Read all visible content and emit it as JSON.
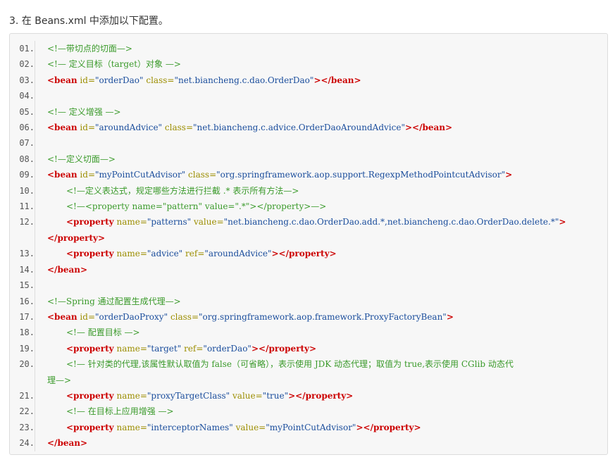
{
  "heading": "3. 在 Beans.xml 中添加以下配置。",
  "lines": [
    {
      "n": "01.",
      "ind": 0,
      "parts": [
        [
          "cmt",
          "<!—带切点的切面—>"
        ]
      ]
    },
    {
      "n": "02.",
      "ind": 0,
      "parts": [
        [
          "cmt",
          "<!— 定义目标（target）对象 —>"
        ]
      ]
    },
    {
      "n": "03.",
      "ind": 0,
      "parts": [
        [
          "tag",
          "<bean"
        ],
        [
          "sp",
          " "
        ],
        [
          "attr",
          "id="
        ],
        [
          "str",
          "\"orderDao\""
        ],
        [
          "sp",
          " "
        ],
        [
          "attr",
          "class="
        ],
        [
          "str",
          "\"net.biancheng.c.dao.OrderDao\""
        ],
        [
          "tag",
          "></bean>"
        ]
      ]
    },
    {
      "n": "04.",
      "ind": 0,
      "parts": []
    },
    {
      "n": "05.",
      "ind": 0,
      "parts": [
        [
          "cmt",
          "<!— 定义增强 —>"
        ]
      ]
    },
    {
      "n": "06.",
      "ind": 0,
      "parts": [
        [
          "tag",
          "<bean"
        ],
        [
          "sp",
          " "
        ],
        [
          "attr",
          "id="
        ],
        [
          "str",
          "\"aroundAdvice\""
        ],
        [
          "sp",
          " "
        ],
        [
          "attr",
          "class="
        ],
        [
          "str",
          "\"net.biancheng.c.advice.OrderDaoAroundAdvice\""
        ],
        [
          "tag",
          "></bean>"
        ]
      ]
    },
    {
      "n": "07.",
      "ind": 0,
      "parts": []
    },
    {
      "n": "08.",
      "ind": 0,
      "parts": [
        [
          "cmt",
          "<!—定义切面—>"
        ]
      ]
    },
    {
      "n": "09.",
      "ind": 0,
      "parts": [
        [
          "tag",
          "<bean"
        ],
        [
          "sp",
          " "
        ],
        [
          "attr",
          "id="
        ],
        [
          "str",
          "\"myPointCutAdvisor\""
        ],
        [
          "sp",
          " "
        ],
        [
          "attr",
          "class="
        ],
        [
          "str",
          "\"org.springframework.aop.support.RegexpMethodPointcutAdvisor\""
        ],
        [
          "tag",
          ">"
        ]
      ]
    },
    {
      "n": "10.",
      "ind": 1,
      "parts": [
        [
          "cmt",
          "<!—定义表达式，规定哪些方法进行拦截 .* 表示所有方法—>"
        ]
      ]
    },
    {
      "n": "11.",
      "ind": 1,
      "parts": [
        [
          "cmt",
          "<!—<property name=\"pattern\" value=\".*\"></property>—>"
        ]
      ]
    },
    {
      "n": "12.",
      "ind": 1,
      "parts": [
        [
          "tag",
          "<property"
        ],
        [
          "sp",
          " "
        ],
        [
          "attr",
          "name="
        ],
        [
          "str",
          "\"patterns\""
        ],
        [
          "sp",
          " "
        ],
        [
          "attr",
          "value="
        ],
        [
          "str",
          "\"net.biancheng.c.dao.OrderDao.add.*,net.biancheng.c.dao.OrderDao.delete.*\""
        ],
        [
          "tag",
          ">"
        ],
        [
          "br",
          ""
        ],
        [
          "tag",
          "</property>"
        ]
      ]
    },
    {
      "n": "13.",
      "ind": 1,
      "parts": [
        [
          "tag",
          "<property"
        ],
        [
          "sp",
          " "
        ],
        [
          "attr",
          "name="
        ],
        [
          "str",
          "\"advice\""
        ],
        [
          "sp",
          " "
        ],
        [
          "attr",
          "ref="
        ],
        [
          "str",
          "\"aroundAdvice\""
        ],
        [
          "tag",
          "></property>"
        ]
      ]
    },
    {
      "n": "14.",
      "ind": 0,
      "parts": [
        [
          "tag",
          "</bean>"
        ]
      ]
    },
    {
      "n": "15.",
      "ind": 0,
      "parts": []
    },
    {
      "n": "16.",
      "ind": 0,
      "parts": [
        [
          "cmt",
          "<!—Spring 通过配置生成代理—>"
        ]
      ]
    },
    {
      "n": "17.",
      "ind": 0,
      "parts": [
        [
          "tag",
          "<bean"
        ],
        [
          "sp",
          " "
        ],
        [
          "attr",
          "id="
        ],
        [
          "str",
          "\"orderDaoProxy\""
        ],
        [
          "sp",
          " "
        ],
        [
          "attr",
          "class="
        ],
        [
          "str",
          "\"org.springframework.aop.framework.ProxyFactoryBean\""
        ],
        [
          "tag",
          ">"
        ]
      ]
    },
    {
      "n": "18.",
      "ind": 1,
      "parts": [
        [
          "cmt",
          "<!— 配置目标 —>"
        ]
      ]
    },
    {
      "n": "19.",
      "ind": 1,
      "parts": [
        [
          "tag",
          "<property"
        ],
        [
          "sp",
          " "
        ],
        [
          "attr",
          "name="
        ],
        [
          "str",
          "\"target\""
        ],
        [
          "sp",
          " "
        ],
        [
          "attr",
          "ref="
        ],
        [
          "str",
          "\"orderDao\""
        ],
        [
          "tag",
          "></property>"
        ]
      ]
    },
    {
      "n": "20.",
      "ind": 1,
      "parts": [
        [
          "cmt",
          "<!— 针对类的代理,该属性默认取值为 false（可省略），表示使用 JDK 动态代理；取值为 true,表示使用 CGlib 动态代"
        ],
        [
          "br",
          ""
        ],
        [
          "cmt",
          "理—>"
        ]
      ]
    },
    {
      "n": "21.",
      "ind": 1,
      "parts": [
        [
          "tag",
          "<property"
        ],
        [
          "sp",
          " "
        ],
        [
          "attr",
          "name="
        ],
        [
          "str",
          "\"proxyTargetClass\""
        ],
        [
          "sp",
          " "
        ],
        [
          "attr",
          "value="
        ],
        [
          "str",
          "\"true\""
        ],
        [
          "tag",
          "></property>"
        ]
      ]
    },
    {
      "n": "22.",
      "ind": 1,
      "parts": [
        [
          "cmt",
          "<!— 在目标上应用增强 —>"
        ]
      ]
    },
    {
      "n": "23.",
      "ind": 1,
      "parts": [
        [
          "tag",
          "<property"
        ],
        [
          "sp",
          " "
        ],
        [
          "attr",
          "name="
        ],
        [
          "str",
          "\"interceptorNames\""
        ],
        [
          "sp",
          " "
        ],
        [
          "attr",
          "value="
        ],
        [
          "str",
          "\"myPointCutAdvisor\""
        ],
        [
          "tag",
          "></property>"
        ]
      ]
    },
    {
      "n": "24.",
      "ind": 0,
      "parts": [
        [
          "tag",
          "</bean>"
        ]
      ]
    }
  ],
  "colors": {
    "comment": "#3a9a2a",
    "tag": "#cc0000",
    "attribute": "#9c8e00",
    "string": "#1a4d9c",
    "line_number": "#555555",
    "background": "#f7f7f7"
  }
}
